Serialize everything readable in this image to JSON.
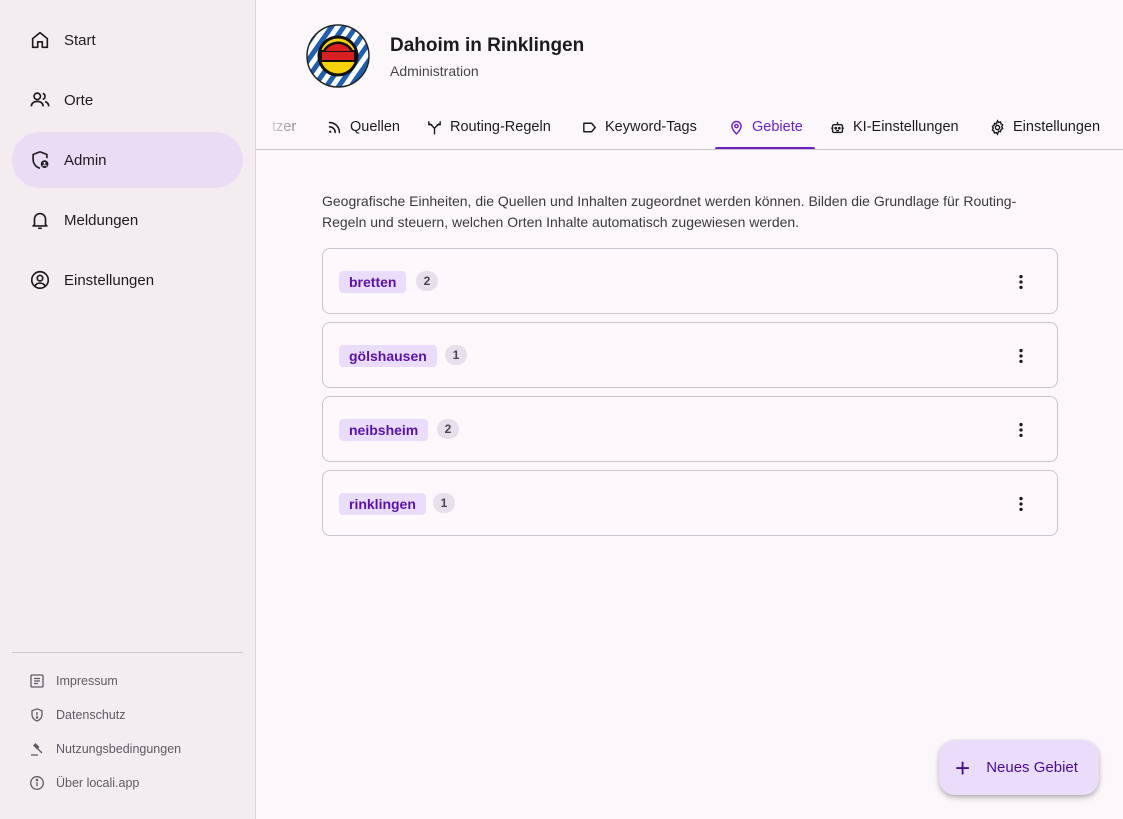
{
  "sidebar": {
    "nav": [
      {
        "label": "Start",
        "icon": "home-icon"
      },
      {
        "label": "Orte",
        "icon": "people-icon"
      },
      {
        "label": "Admin",
        "icon": "admin-shield-icon",
        "active": true
      },
      {
        "label": "Meldungen",
        "icon": "bell-icon"
      },
      {
        "label": "Einstellungen",
        "icon": "account-circle-icon"
      }
    ],
    "footer": [
      {
        "label": "Impressum",
        "icon": "article-icon"
      },
      {
        "label": "Datenschutz",
        "icon": "shield-icon"
      },
      {
        "label": "Nutzungsbedingungen",
        "icon": "gavel-icon"
      },
      {
        "label": "Über locali.app",
        "icon": "info-icon"
      }
    ]
  },
  "header": {
    "title": "Dahoim in Rinklingen",
    "subtitle": "Administration"
  },
  "tabs": [
    {
      "label": "tzer",
      "icon": null
    },
    {
      "label": "Quellen",
      "icon": "rss-icon"
    },
    {
      "label": "Routing-Regeln",
      "icon": "fork-icon"
    },
    {
      "label": "Keyword-Tags",
      "icon": "label-icon"
    },
    {
      "label": "Gebiete",
      "icon": "location-pin-icon",
      "active": true
    },
    {
      "label": "KI-Einstellungen",
      "icon": "robot-icon"
    },
    {
      "label": "Einstellungen",
      "icon": "gear-icon"
    }
  ],
  "content": {
    "description": "Geografische Einheiten, die Quellen und Inhalten zugeordnet werden können. Bilden die Grundlage für Routing-Regeln und steuern, welchen Orten Inhalte automatisch zugewiesen werden.",
    "areas": [
      {
        "name": "bretten",
        "count": "2"
      },
      {
        "name": "gölshausen",
        "count": "1"
      },
      {
        "name": "neibsheim",
        "count": "2"
      },
      {
        "name": "rinklingen",
        "count": "1"
      }
    ]
  },
  "fab": {
    "label": "Neues Gebiet",
    "icon": "plus-icon"
  },
  "colors": {
    "accent": "#6d1fc8",
    "chip_bg": "#eaddfb",
    "active_nav_bg": "#e9ddf6",
    "sidebar_bg": "#f3edf2"
  }
}
